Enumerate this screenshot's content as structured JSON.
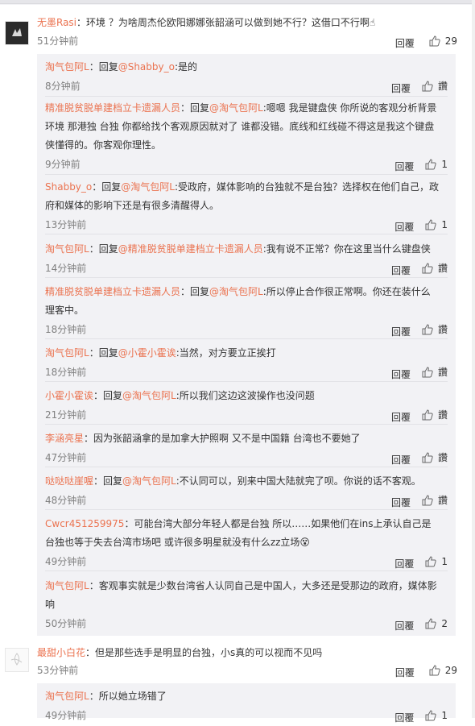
{
  "ui": {
    "reply_label": "回覆",
    "like_zh": "讚"
  },
  "comments": [
    {
      "user": "无墨Rasi",
      "text": "：环境 ？为啥周杰伦欧阳娜娜张韶涵可以做到她不行？这借口不行啊☝",
      "time": "51分钟前",
      "likes": "29"
    },
    {
      "user": "最甜小白花",
      "text": "：但是那些选手是明显的台独，小s真的可以视而不见吗",
      "time": "53分钟前",
      "likes": "29"
    }
  ],
  "replies": [
    {
      "user": "淘气包阿L",
      "pre": "：回复",
      "mention": "@Shabby_o",
      "text": ":是的",
      "time": "8分钟前",
      "likes": "讚"
    },
    {
      "user": "精准脱贫脱单建档立卡遗漏人员",
      "pre": "：回复",
      "mention": "@淘气包阿L",
      "text": ":嗯嗯 我是键盘侠 你所说的客观分析背景环境 那港独 台独 你都给找个客观原因就对了 谁都没错。底线和红线碰不得这是我这个键盘侠懂得的。你客观你理性。",
      "time": "9分钟前",
      "likes": "1"
    },
    {
      "user": "Shabby_o",
      "pre": "：回复",
      "mention": "@淘气包阿L",
      "text": ":受政府，媒体影响的台独就不是台独？选择权在他们自己，政府和媒体的影响下还是有很多清醒得人。",
      "time": "13分钟前",
      "likes": "1"
    },
    {
      "user": "淘气包阿L",
      "pre": "：回复",
      "mention": "@精准脱贫脱单建档立卡遗漏人员",
      "text": ":我有说不正常？你在这里当什么键盘侠",
      "time": "14分钟前",
      "likes": "讚"
    },
    {
      "user": "精准脱贫脱单建档立卡遗漏人员",
      "pre": "：回复",
      "mention": "@淘气包阿L",
      "text": ":所以停止合作很正常啊。你还在装什么理客中。",
      "time": "18分钟前",
      "likes": "讚"
    },
    {
      "user": "淘气包阿L",
      "pre": "：回复",
      "mention": "@小霍小霍诶",
      "text": ":当然，对方要立正挨打",
      "time": "18分钟前",
      "likes": "讚"
    },
    {
      "user": "小霍小霍诶",
      "pre": "：回复",
      "mention": "@淘气包阿L",
      "text": ":所以我们这边这波操作也没问题",
      "time": "21分钟前",
      "likes": "讚"
    },
    {
      "user": "李涵亮星",
      "pre": "",
      "mention": "",
      "text": "：因为张韶涵拿的是加拿大护照啊 又不是中国籍 台湾也不要她了",
      "time": "47分钟前",
      "likes": "讚"
    },
    {
      "user": "哒哒哒崖喔",
      "pre": "：回复",
      "mention": "@淘气包阿L",
      "text": ":不认同可以，别来中国大陆就完了呗。你说的话不客观。",
      "time": "48分钟前",
      "likes": "讚"
    },
    {
      "user": "Cwcr451259975",
      "pre": "",
      "mention": "",
      "text": "：可能台湾大部分年轻人都是台独 所以……如果他们在ins上承认自己是台独也等于失去台湾市场吧 或许很多明星就没有什么zz立场😵",
      "time": "49分钟前",
      "likes": "1"
    },
    {
      "user": "淘气包阿L",
      "pre": "",
      "mention": "",
      "text": "：客观事实就是少数台湾省人认同自己是中国人，大多还是受那边的政府，媒体影响",
      "time": "50分钟前",
      "likes": "2"
    },
    {
      "user": "淘气包阿L",
      "pre": "",
      "mention": "",
      "text": "：所以她立场错了",
      "time": "49分钟前",
      "likes": "1"
    }
  ]
}
